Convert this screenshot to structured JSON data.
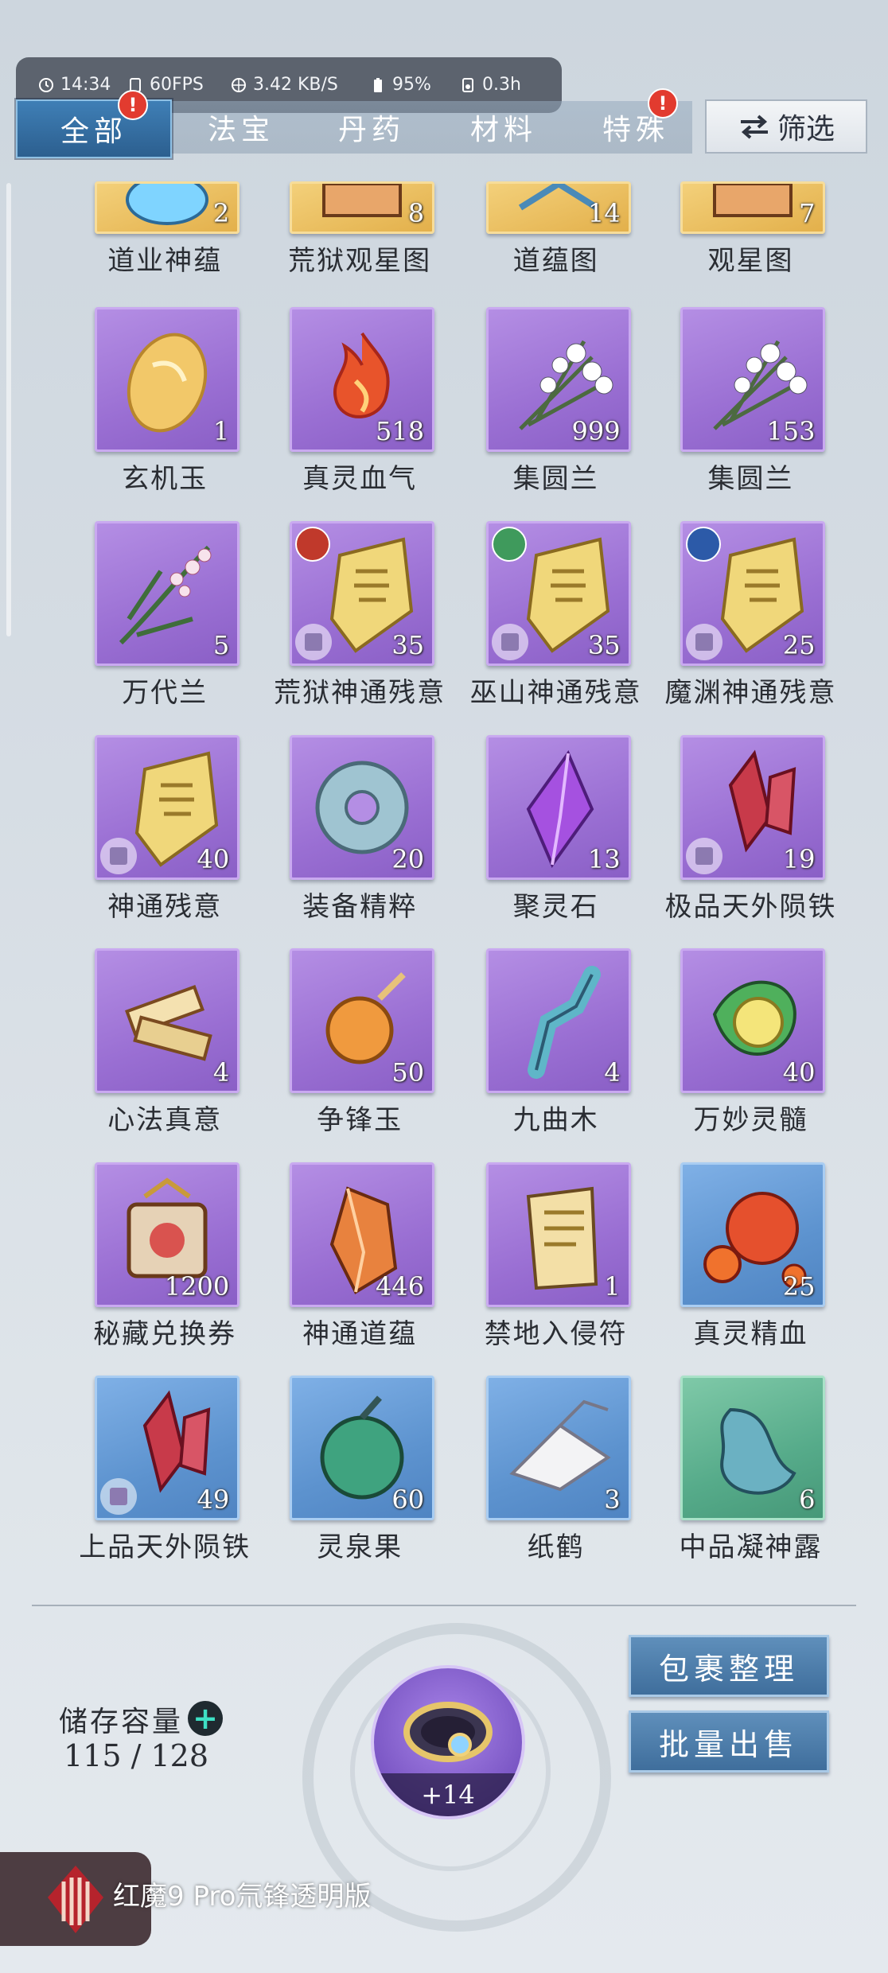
{
  "status_bar": {
    "time": "14:34",
    "fps": "60FPS",
    "network": "3.42 KB/S",
    "battery": "95%",
    "duration": "0.3h"
  },
  "tabs": [
    {
      "label": "全部",
      "active": true,
      "badge": "!"
    },
    {
      "label": "法宝",
      "active": false
    },
    {
      "label": "丹药",
      "active": false
    },
    {
      "label": "材料",
      "active": false
    },
    {
      "label": "特殊",
      "active": false,
      "badge": "!"
    }
  ],
  "filter_button": {
    "label": "筛选",
    "icon": "swap-arrows-icon"
  },
  "items": [
    {
      "name": "道业神蕴",
      "count": "2",
      "rarity": "gold",
      "icon": "aura-orb-icon"
    },
    {
      "name": "荒狱观星图",
      "count": "8",
      "rarity": "gold",
      "icon": "star-chart-icon"
    },
    {
      "name": "道蕴图",
      "count": "14",
      "rarity": "gold",
      "icon": "dao-chart-icon"
    },
    {
      "name": "观星图",
      "count": "7",
      "rarity": "gold",
      "icon": "star-chart-icon"
    },
    {
      "name": "玄机玉",
      "count": "1",
      "rarity": "purple",
      "icon": "jade-stone-icon"
    },
    {
      "name": "真灵血气",
      "count": "518",
      "rarity": "purple",
      "icon": "blood-flame-icon"
    },
    {
      "name": "集圆兰",
      "count": "999",
      "rarity": "purple",
      "icon": "orchid-flower-icon"
    },
    {
      "name": "集圆兰",
      "count": "153",
      "rarity": "purple",
      "icon": "orchid-flower-icon"
    },
    {
      "name": "万代兰",
      "count": "5",
      "rarity": "purple",
      "icon": "orchid-branch-icon"
    },
    {
      "name": "荒狱神通残意",
      "count": "35",
      "rarity": "purple",
      "icon": "golden-scroll-fragment-icon",
      "fragment": true,
      "element_color": "#c0392b"
    },
    {
      "name": "巫山神通残意",
      "count": "35",
      "rarity": "purple",
      "icon": "golden-scroll-fragment-icon",
      "fragment": true,
      "element_color": "#3f9a5c"
    },
    {
      "name": "魔渊神通残意",
      "count": "25",
      "rarity": "purple",
      "icon": "golden-scroll-fragment-icon",
      "fragment": true,
      "element_color": "#2c5aa8"
    },
    {
      "name": "神通残意",
      "count": "40",
      "rarity": "purple",
      "icon": "golden-scroll-fragment-icon",
      "fragment": true
    },
    {
      "name": "装备精粹",
      "count": "20",
      "rarity": "purple",
      "icon": "jade-ring-icon"
    },
    {
      "name": "聚灵石",
      "count": "13",
      "rarity": "purple",
      "icon": "purple-crystal-icon"
    },
    {
      "name": "极品天外陨铁",
      "count": "19",
      "rarity": "purple",
      "icon": "red-crystal-icon",
      "fragment": true
    },
    {
      "name": "心法真意",
      "count": "4",
      "rarity": "purple",
      "icon": "scroll-bundle-icon"
    },
    {
      "name": "争锋玉",
      "count": "50",
      "rarity": "purple",
      "icon": "amber-pendant-icon"
    },
    {
      "name": "九曲木",
      "count": "4",
      "rarity": "purple",
      "icon": "blue-wood-icon"
    },
    {
      "name": "万妙灵髓",
      "count": "40",
      "rarity": "purple",
      "icon": "green-leaf-orb-icon"
    },
    {
      "name": "秘藏兑换券",
      "count": "1200",
      "rarity": "purple",
      "icon": "treasure-ticket-icon"
    },
    {
      "name": "神通道蕴",
      "count": "446",
      "rarity": "purple",
      "icon": "orange-crystal-icon"
    },
    {
      "name": "禁地入侵符",
      "count": "1",
      "rarity": "purple",
      "icon": "talisman-icon"
    },
    {
      "name": "真灵精血",
      "count": "25",
      "rarity": "blue",
      "icon": "fire-orbs-icon"
    },
    {
      "name": "上品天外陨铁",
      "count": "49",
      "rarity": "blue",
      "icon": "red-crystal-icon",
      "fragment": true
    },
    {
      "name": "灵泉果",
      "count": "60",
      "rarity": "blue",
      "icon": "green-fruit-icon"
    },
    {
      "name": "纸鹤",
      "count": "3",
      "rarity": "blue",
      "icon": "paper-crane-icon"
    },
    {
      "name": "中品凝神露",
      "count": "6",
      "rarity": "green",
      "icon": "dew-flask-icon"
    }
  ],
  "storage": {
    "label": "储存容量",
    "value": "115 / 128",
    "add_icon": "plus-icon"
  },
  "bag_ring": {
    "plus": "+14",
    "icon": "storage-ring-icon"
  },
  "buttons": {
    "organize": "包裹整理",
    "bulk_sell": "批量出售"
  },
  "promo": {
    "text": "红魔9 Pro氘锋透明版",
    "icon": "red-magic-logo-icon"
  },
  "colors": {
    "accent": "#3f7fb6",
    "purple_rarity": "#9a6fd3",
    "blue_rarity": "#5d93cf",
    "green_rarity": "#56ab8a",
    "gold_rarity": "#e3b04b",
    "badge": "#e23b2f"
  }
}
